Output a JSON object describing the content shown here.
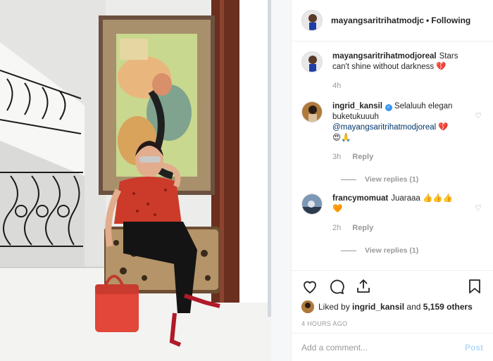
{
  "header": {
    "username": "mayangsaritrihatmodjc",
    "separator": "•",
    "follow_label": "Following"
  },
  "comments": [
    {
      "username": "mayangsaritrihatmodjoreal",
      "text": "Stars can't shine without darkness",
      "emoji": "💔",
      "time": "4h"
    },
    {
      "username": "ingrid_kansil",
      "verified_icon": "verified-badge",
      "text": "Selaluuh elegan buketukuuuh",
      "mention": "@mayangsaritrihatmodjoreal",
      "emoji": "💔",
      "emoji2": "😍🙏",
      "time": "3h",
      "reply_label": "Reply",
      "view_replies": "View replies (1)"
    },
    {
      "username": "francymomuat",
      "text": "Juaraaa",
      "emoji": "👍👍👍",
      "emoji2": "🧡",
      "time": "2h",
      "reply_label": "Reply",
      "view_replies": "View replies (1)"
    }
  ],
  "likes": {
    "prefix": "Liked by",
    "user": "ingrid_kansil",
    "and": "and",
    "count": "5,159 others"
  },
  "timestamp": "4 HOURS AGO",
  "add_comment": {
    "placeholder": "Add a comment...",
    "post_label": "Post"
  },
  "colors": {
    "verified": "#3897f0",
    "post_disabled": "#b3dbff",
    "meta": "#999999"
  }
}
